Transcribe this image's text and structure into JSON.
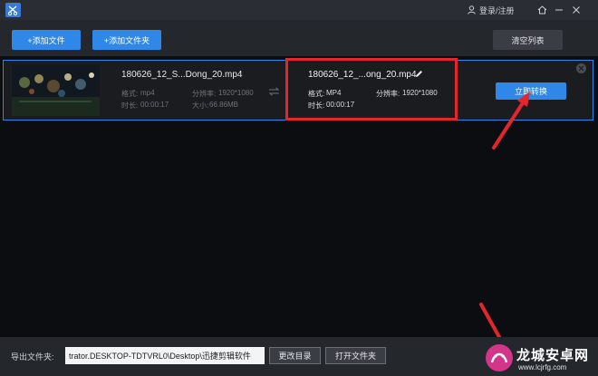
{
  "titlebar": {
    "login_label": "登录/注册"
  },
  "toolbar": {
    "add_file_label": "+添加文件",
    "add_folder_label": "+添加文件夹",
    "clear_list_label": "清空列表"
  },
  "file": {
    "source": {
      "name": "180626_12_S...Dong_20.mp4",
      "format_label": "格式:",
      "format_value": "mp4",
      "resolution_label": "分辨率:",
      "resolution_value": "1920*1080",
      "duration_label": "时长:",
      "duration_value": "00:00:17",
      "size_label": "大小:",
      "size_value": "66.86MB"
    },
    "target": {
      "name": "180626_12_...ong_20.mp4",
      "format_label": "格式:",
      "format_value": "MP4",
      "resolution_label": "分辨率:",
      "resolution_value": "1920*1080",
      "duration_label": "时长:",
      "duration_value": "00:00:17"
    },
    "convert_label": "立即转换"
  },
  "bottombar": {
    "export_label": "导出文件夹:",
    "export_path": "trator.DESKTOP-TDTVRL0\\Desktop\\迅捷剪辑软件",
    "change_dir_label": "更改目录",
    "open_folder_label": "打开文件夹"
  },
  "watermark": {
    "title": "龙城安卓网",
    "url": "www.lcjrfg.com"
  },
  "colors": {
    "accent": "#2f87e8",
    "highlight": "#e3262b",
    "background": "#0b0d10"
  }
}
